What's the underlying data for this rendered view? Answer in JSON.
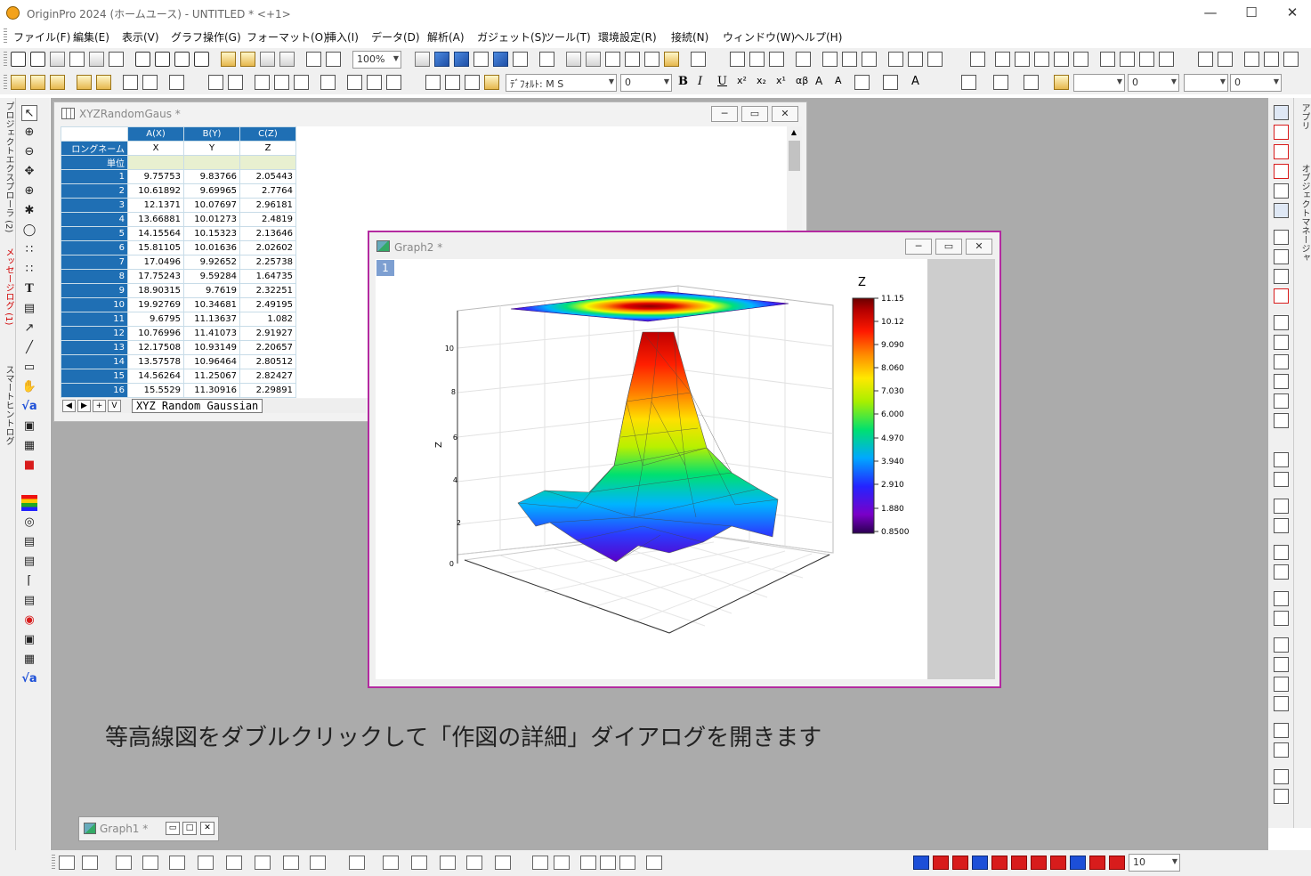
{
  "app": {
    "title": "OriginPro 2024 (ホームユース) - UNTITLED * <+1>"
  },
  "menu": [
    "ファイル(F)",
    "編集(E)",
    "表示(V)",
    "グラフ操作(G)",
    "フォーマット(O)",
    "挿入(I)",
    "データ(D)",
    "解析(A)",
    "ガジェット(S)",
    "ツール(T)",
    "環境設定(R)",
    "接続(N)",
    "ウィンドウ(W)",
    "ヘルプ(H)"
  ],
  "toolbar": {
    "zoom": "100%",
    "font": "ﾃﾞﾌｫﾙﾄ: M S",
    "font_size": "0",
    "line_size": "0",
    "fill_size": "0"
  },
  "left_dock": {
    "project_explorer": "プロジェクトエクスプローラ (2)",
    "messages": "メッセージログ (1)",
    "smart_hint": "スマートヒントログ"
  },
  "right_dock": {
    "apps": "アプリ",
    "object_manager": "オブジェクトマネージャ"
  },
  "worksheet": {
    "title": "XYZRandomGaus *",
    "columns": [
      "A(X)",
      "B(Y)",
      "C(Z)"
    ],
    "row_labels": {
      "longname": "ロングネーム",
      "units": "単位"
    },
    "longnames": [
      "X",
      "Y",
      "Z"
    ],
    "rows": [
      [
        "1",
        "9.75753",
        "9.83766",
        "2.05443"
      ],
      [
        "2",
        "10.61892",
        "9.69965",
        "2.7764"
      ],
      [
        "3",
        "12.1371",
        "10.07697",
        "2.96181"
      ],
      [
        "4",
        "13.66881",
        "10.01273",
        "2.4819"
      ],
      [
        "5",
        "14.15564",
        "10.15323",
        "2.13646"
      ],
      [
        "6",
        "15.81105",
        "10.01636",
        "2.02602"
      ],
      [
        "7",
        "17.0496",
        "9.92652",
        "2.25738"
      ],
      [
        "8",
        "17.75243",
        "9.59284",
        "1.64735"
      ],
      [
        "9",
        "18.90315",
        "9.7619",
        "2.32251"
      ],
      [
        "10",
        "19.92769",
        "10.34681",
        "2.49195"
      ],
      [
        "11",
        "9.6795",
        "11.13637",
        "1.082"
      ],
      [
        "12",
        "10.76996",
        "11.41073",
        "2.91927"
      ],
      [
        "13",
        "12.17508",
        "10.93149",
        "2.20657"
      ],
      [
        "14",
        "13.57578",
        "10.96464",
        "2.80512"
      ],
      [
        "15",
        "14.56264",
        "11.25067",
        "2.82427"
      ],
      [
        "16",
        "15.5529",
        "11.30916",
        "2.29891"
      ]
    ],
    "sheet_tab": "XYZ Random Gaussian",
    "nav_buttons": [
      "◀",
      "▶",
      "+",
      "V"
    ]
  },
  "graph2": {
    "title": "Graph2 *",
    "layer": "1",
    "z_axis_label": "Z",
    "z_ticks": [
      "0",
      "2",
      "4",
      "6",
      "8",
      "10"
    ],
    "colorbar_title": "Z",
    "colorbar_levels": [
      "11.15",
      "10.12",
      "9.090",
      "8.060",
      "7.030",
      "6.000",
      "4.970",
      "3.940",
      "2.910",
      "1.880",
      "0.8500"
    ]
  },
  "graph1": {
    "title": "Graph1 *"
  },
  "caption": "等高線図をダブルクリックして「作図の詳細」ダイアログを開きます",
  "bottom_toolbar": {
    "size": "10"
  }
}
